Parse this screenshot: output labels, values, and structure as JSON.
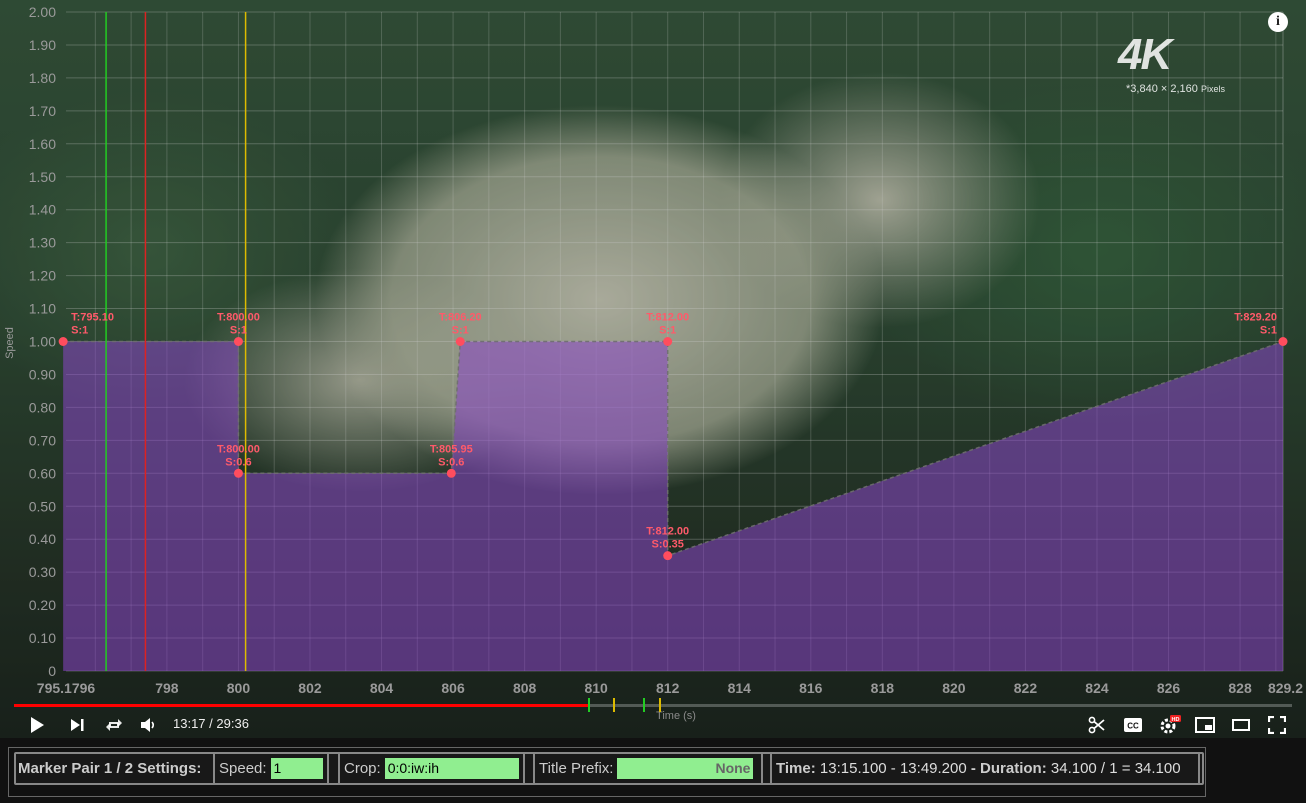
{
  "video": {
    "badge_4k": "4K",
    "badge_resolution": "*3,840 × 2,160",
    "badge_pixels_unit": "Pixels",
    "info_icon": "i"
  },
  "chart_data": {
    "type": "line",
    "ylabel": "Speed",
    "xlabel": "Time (s)",
    "xlim": [
      795.1796,
      829.2
    ],
    "ylim": [
      0,
      2
    ],
    "y_ticks": [
      "0",
      "0.10",
      "0.20",
      "0.30",
      "0.40",
      "0.50",
      "0.60",
      "0.70",
      "0.80",
      "0.90",
      "1.00",
      "1.10",
      "1.20",
      "1.30",
      "1.40",
      "1.50",
      "1.60",
      "1.70",
      "1.80",
      "1.90",
      "2.00"
    ],
    "x_ticks": [
      795.1796,
      798,
      800,
      802,
      804,
      806,
      808,
      810,
      812,
      814,
      816,
      818,
      820,
      822,
      824,
      826,
      828,
      829.2
    ],
    "x_tick_labels": [
      "795.1796",
      "798",
      "800",
      "802",
      "804",
      "806",
      "808",
      "810",
      "812",
      "814",
      "816",
      "818",
      "820",
      "822",
      "824",
      "826",
      "828",
      "829.2"
    ],
    "points": [
      {
        "x": 795.1,
        "y": 1,
        "label_t": "T:795.10",
        "label_s": "S:1"
      },
      {
        "x": 800.0,
        "y": 1,
        "label_t": "T:800.00",
        "label_s": "S:1"
      },
      {
        "x": 800.0,
        "y": 0.6,
        "label_t": "T:800.00",
        "label_s": "S:0.6"
      },
      {
        "x": 805.95,
        "y": 0.6,
        "label_t": "T:805.95",
        "label_s": "S:0.6"
      },
      {
        "x": 806.2,
        "y": 1,
        "label_t": "T:806.20",
        "label_s": "S:1"
      },
      {
        "x": 812.0,
        "y": 1,
        "label_t": "T:812.00",
        "label_s": "S:1"
      },
      {
        "x": 812.0,
        "y": 0.35,
        "label_t": "T:812.00",
        "label_s": "S:0.35"
      },
      {
        "x": 829.2,
        "y": 1,
        "label_t": "T:829.20",
        "label_s": "S:1"
      }
    ],
    "vertical_markers": [
      {
        "x": 796.3,
        "color": "#22cc22"
      },
      {
        "x": 797.4,
        "color": "#dd2222"
      },
      {
        "x": 800.2,
        "color": "#ddbb00"
      }
    ],
    "area_color": "#8a45c8",
    "point_color": "#ff4d5e",
    "label_color": "#ff5a6a",
    "grid": true
  },
  "player": {
    "time_current": "13:17",
    "time_separator": "/",
    "time_total": "29:36",
    "progress_fraction": 0.449,
    "progress_color": "#ff0000",
    "marker_positions": [
      {
        "fraction": 0.449,
        "color": "#22cc22"
      },
      {
        "fraction": 0.469,
        "color": "#ddbb00"
      },
      {
        "fraction": 0.492,
        "color": "#22cc22"
      },
      {
        "fraction": 0.505,
        "color": "#ddbb00"
      }
    ]
  },
  "settings": {
    "title": "Marker Pair 1 / 2 Settings:",
    "speed_label": "Speed:",
    "speed_value": "1",
    "crop_label": "Crop:",
    "crop_value": "0:0:iw:ih",
    "title_prefix_label": "Title Prefix:",
    "title_prefix_value": "None",
    "time_label": "Time:",
    "time_value": "13:15.100 - 13:49.200",
    "duration_separator": "-",
    "duration_label": "Duration:",
    "duration_value": "34.100 / 1 = 34.100"
  }
}
